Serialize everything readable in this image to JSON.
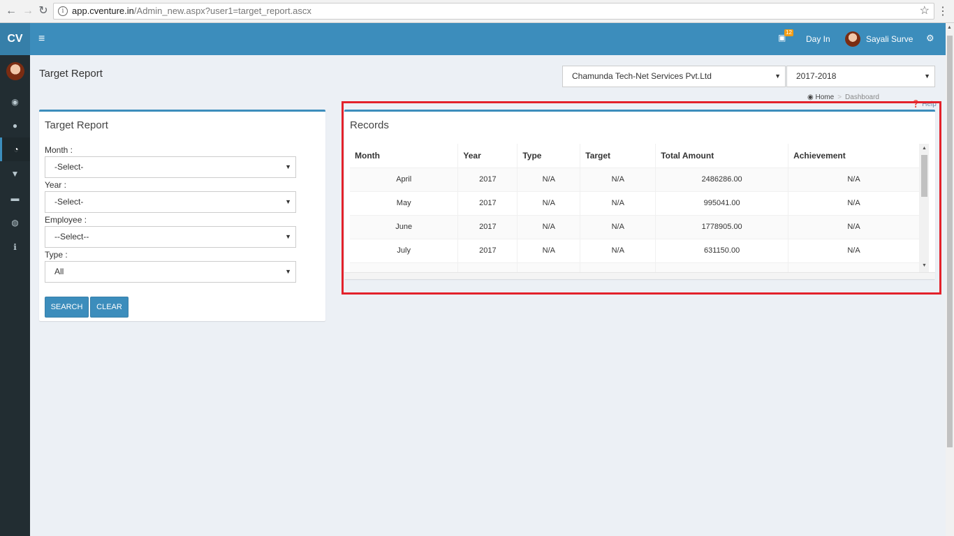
{
  "browser": {
    "url_host": "app.cventure.in",
    "url_path": "/Admin_new.aspx?user1=target_report.ascx"
  },
  "sidebar": {
    "logo": "CV",
    "items": [
      {
        "icon": "dashboard-icon",
        "glyph": "◉"
      },
      {
        "icon": "user-icon",
        "glyph": "●"
      },
      {
        "icon": "pie-chart-icon",
        "glyph": "◔",
        "active": true
      },
      {
        "icon": "cart-icon",
        "glyph": "▼"
      },
      {
        "icon": "credit-card-icon",
        "glyph": "▬"
      },
      {
        "icon": "globe-icon",
        "glyph": "◍"
      },
      {
        "icon": "info-icon",
        "glyph": "ℹ"
      }
    ]
  },
  "header": {
    "notification_count": "12",
    "day_in_label": "Day In",
    "user_name": "Sayali Surve"
  },
  "page": {
    "title": "Target Report",
    "company_select": "Chamunda Tech-Net Services Pvt.Ltd",
    "year_select": "2017-2018",
    "breadcrumb_home": "Home",
    "breadcrumb_current": "Dashboard",
    "help_label": "Help"
  },
  "filter": {
    "title": "Target Report",
    "month_label": "Month :",
    "month_value": "-Select-",
    "year_label": "Year :",
    "year_value": "-Select-",
    "employee_label": "Employee :",
    "employee_value": "--Select--",
    "type_label": "Type :",
    "type_value": "All",
    "search_button": "SEARCH",
    "clear_button": "CLEAR"
  },
  "records": {
    "title": "Records",
    "columns": [
      "Month",
      "Year",
      "Type",
      "Target",
      "Total Amount",
      "Achievement"
    ],
    "rows": [
      [
        "April",
        "2017",
        "N/A",
        "N/A",
        "2486286.00",
        "N/A"
      ],
      [
        "May",
        "2017",
        "N/A",
        "N/A",
        "995041.00",
        "N/A"
      ],
      [
        "June",
        "2017",
        "N/A",
        "N/A",
        "1778905.00",
        "N/A"
      ],
      [
        "July",
        "2017",
        "N/A",
        "N/A",
        "631150.00",
        "N/A"
      ]
    ]
  }
}
